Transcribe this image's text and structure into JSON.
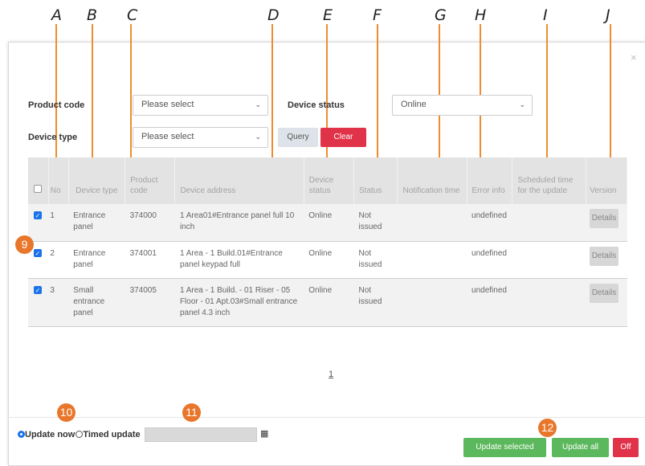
{
  "columns_letters": [
    "A",
    "B",
    "C",
    "D",
    "E",
    "F",
    "G",
    "H",
    "I",
    "J"
  ],
  "dialog": {
    "close_icon": "×"
  },
  "filters": {
    "product_code_label": "Product code",
    "product_code_value": "Please select",
    "device_status_label": "Device status",
    "device_status_value": "Online",
    "device_type_label": "Device type",
    "device_type_value": "Please select",
    "query_label": "Query",
    "clear_label": "Clear"
  },
  "table": {
    "headers": {
      "no": "No",
      "device_type": "Device type",
      "product_code": "Product code",
      "device_address": "Device address",
      "device_status": "Device status",
      "status": "Status",
      "notification_time": "Notification time",
      "error_info": "Error info",
      "scheduled": "Scheduled time for the update",
      "version": "Version"
    },
    "rows": [
      {
        "no": "1",
        "device_type": "Entrance panel",
        "product_code": "374000",
        "device_address": "1 Area01#Entrance panel full 10 inch",
        "device_status": "Online",
        "status": "Not issued",
        "notification_time": "",
        "error_info": "undefined",
        "scheduled": "",
        "details": "Details"
      },
      {
        "no": "2",
        "device_type": "Entrance panel",
        "product_code": "374001",
        "device_address": "1 Area - 1 Build.01#Entrance panel keypad full",
        "device_status": "Online",
        "status": "Not issued",
        "notification_time": "",
        "error_info": "undefined",
        "scheduled": "",
        "details": "Details"
      },
      {
        "no": "3",
        "device_type": "Small entrance panel",
        "product_code": "374005",
        "device_address": "1 Area - 1 Build. - 01 Riser - 05 Floor - 01 Apt.03#Small entrance panel 4.3 inch",
        "device_status": "Online",
        "status": "Not issued",
        "notification_time": "",
        "error_info": "undefined",
        "scheduled": "",
        "details": "Details"
      }
    ]
  },
  "pagination": {
    "page": "1"
  },
  "footer": {
    "update_now_label": "Update now",
    "timed_update_label": "Timed update",
    "timed_update_value": "",
    "update_selected_label": "Update selected",
    "update_all_label": "Update all",
    "off_label": "Off"
  },
  "badges": {
    "b9": "9",
    "b10": "10",
    "b11": "11",
    "b12": "12"
  },
  "colors": {
    "accent_orange": "#e8762b",
    "green": "#5cb85c",
    "red": "#e0334a",
    "blue": "#1a73e8"
  }
}
